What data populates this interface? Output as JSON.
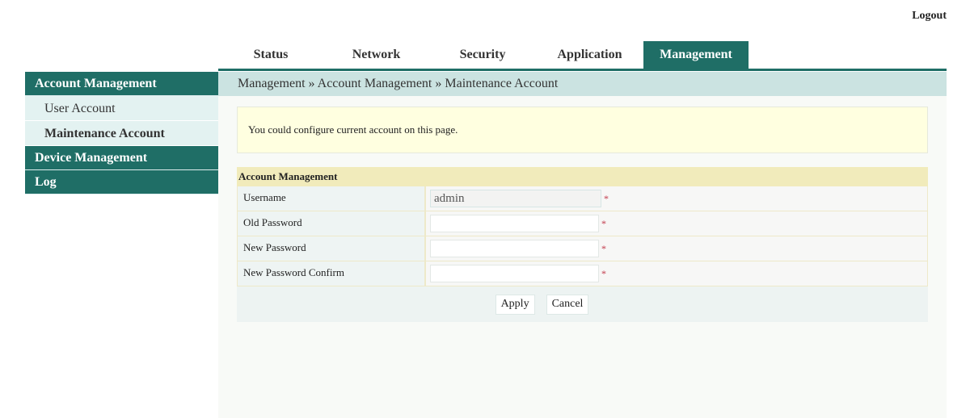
{
  "header": {
    "logout_label": "Logout"
  },
  "topnav": {
    "tabs": [
      {
        "label": "Status",
        "active": false
      },
      {
        "label": "Network",
        "active": false
      },
      {
        "label": "Security",
        "active": false
      },
      {
        "label": "Application",
        "active": false
      },
      {
        "label": "Management",
        "active": true
      }
    ]
  },
  "sidebar": {
    "groups": [
      {
        "label": "Account Management",
        "items": [
          {
            "label": "User Account",
            "active": false
          },
          {
            "label": "Maintenance Account",
            "active": true
          }
        ]
      },
      {
        "label": "Device Management"
      },
      {
        "label": "Log"
      }
    ]
  },
  "breadcrumb": "Management » Account Management » Maintenance Account",
  "info_text": "You could configure current account on this page.",
  "form": {
    "title": "Account Management",
    "fields": [
      {
        "label": "Username",
        "value": "admin",
        "readonly": true,
        "required_mark": "*"
      },
      {
        "label": "Old Password",
        "value": "",
        "required_mark": "*"
      },
      {
        "label": "New Password",
        "value": "",
        "required_mark": "*"
      },
      {
        "label": "New Password Confirm",
        "value": "",
        "required_mark": "*"
      }
    ],
    "apply_label": "Apply",
    "cancel_label": "Cancel"
  },
  "colors": {
    "brand": "#1f6e66",
    "breadcrumb_bg": "#cbe3e1",
    "info_bg": "#ffffe0",
    "form_header_bg": "#f1ebbb",
    "required": "#c23a4b"
  }
}
